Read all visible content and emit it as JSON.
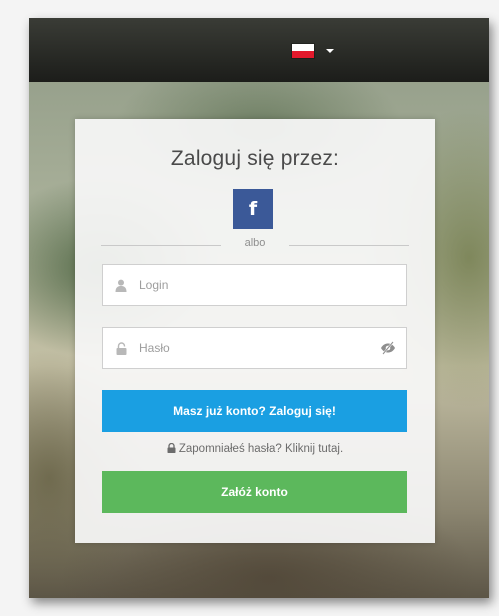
{
  "header": {
    "language_flag_icon": "poland-flag-icon",
    "language_dropdown_icon": "caret-down-icon",
    "colors": {
      "flag_white": "#ffffff",
      "flag_red": "#e3192c"
    }
  },
  "login_panel": {
    "title": "Zaloguj się przez:",
    "facebook_button": {
      "label": "f",
      "icon": "facebook-icon",
      "color": "#3b5998"
    },
    "divider_text": "albo",
    "login_field": {
      "placeholder": "Login",
      "value": "",
      "icon": "user-icon"
    },
    "password_field": {
      "placeholder": "Hasło",
      "value": "",
      "icon": "lock-icon",
      "toggle_icon": "eye-slash-icon"
    },
    "login_button": {
      "label": "Masz już konto? Zaloguj się!",
      "color": "#1a9fe2"
    },
    "forgot_link": {
      "label": "Zapomniałeś hasła? Kliknij tutaj.",
      "icon": "lock-icon"
    },
    "register_button": {
      "label": "Załóż konto",
      "color": "#5cb85c"
    }
  }
}
